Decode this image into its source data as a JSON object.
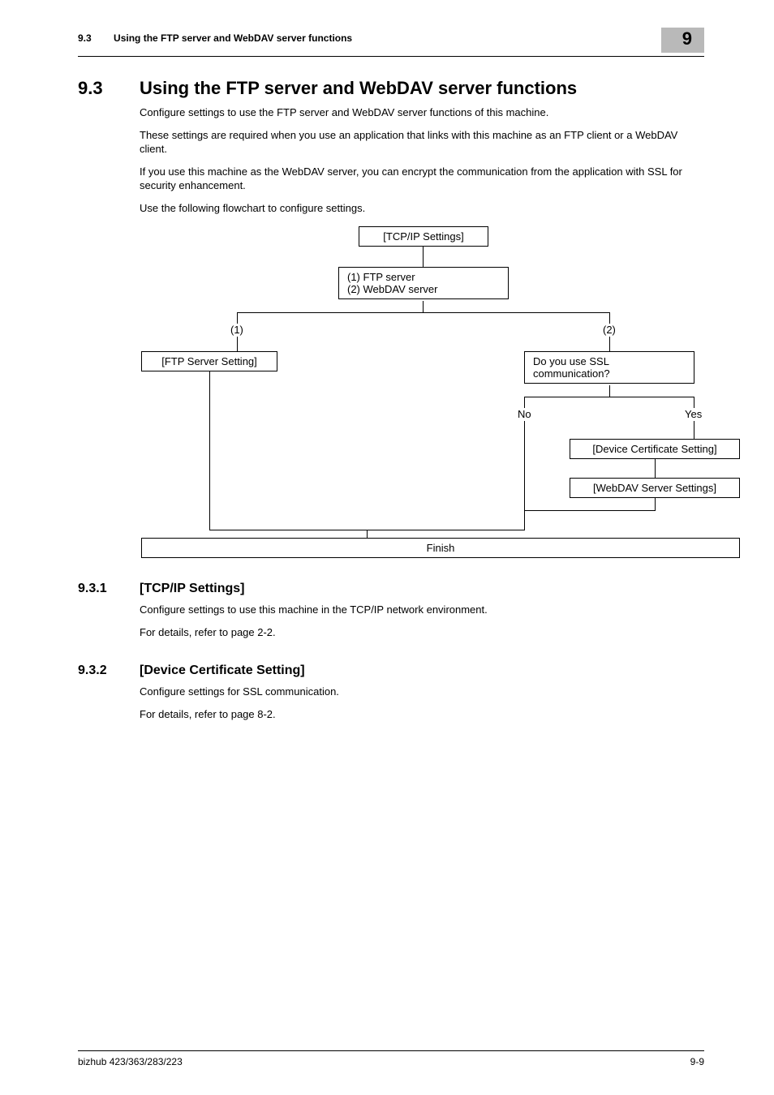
{
  "header": {
    "section_number": "9.3",
    "section_title": "Using the FTP server and WebDAV server functions",
    "chapter_tab": "9"
  },
  "h1": {
    "num": "9.3",
    "txt": "Using the FTP server and WebDAV server functions"
  },
  "intro": {
    "p1": "Configure settings to use the FTP server and WebDAV server functions of this machine.",
    "p2": "These settings are required when you use an application that links with this machine as an FTP client or a WebDAV client.",
    "p3": "If you use this machine as the WebDAV server, you can encrypt the communication from the application with SSL for security enhancement.",
    "p4": "Use the following flowchart to configure settings."
  },
  "flow": {
    "tcpip": "[TCP/IP Settings]",
    "split_l1": "(1) FTP server",
    "split_l2": "(2) WebDAV server",
    "branch1": "(1)",
    "branch2": "(2)",
    "ftp": "[FTP Server Setting]",
    "ssl_q": "Do you use SSL communication?",
    "no": "No",
    "yes": "Yes",
    "devcert": "[Device Certificate Setting]",
    "webdav": "[WebDAV Server Settings]",
    "finish": "Finish"
  },
  "s931": {
    "num": "9.3.1",
    "txt": "[TCP/IP Settings]",
    "p1": "Configure settings to use this machine in the TCP/IP network environment.",
    "p2": "For details, refer to page 2-2."
  },
  "s932": {
    "num": "9.3.2",
    "txt": "[Device Certificate Setting]",
    "p1": "Configure settings for SSL communication.",
    "p2": "For details, refer to page 8-2."
  },
  "footer": {
    "left": "bizhub 423/363/283/223",
    "right": "9-9"
  }
}
